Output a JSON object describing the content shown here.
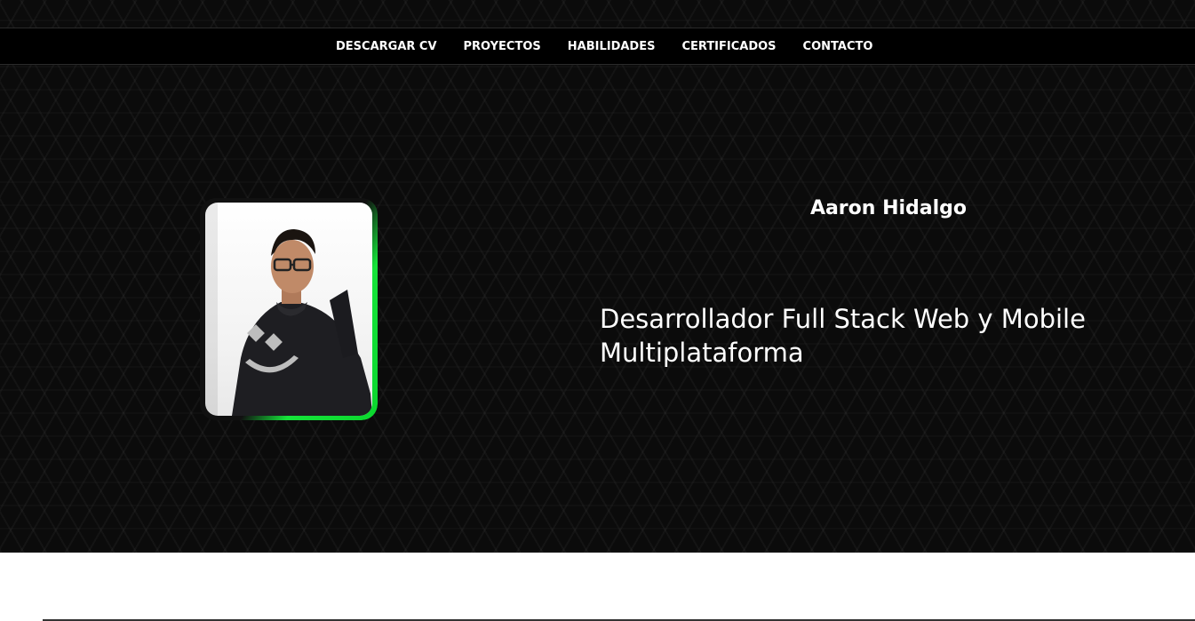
{
  "nav": {
    "items": [
      {
        "label": "DESCARGAR CV"
      },
      {
        "label": "PROYECTOS"
      },
      {
        "label": "HABILIDADES"
      },
      {
        "label": "CERTIFICADOS"
      },
      {
        "label": "CONTACTO"
      }
    ]
  },
  "hero": {
    "name": "Aaron Hidalgo",
    "headline_line1": "Desarrollador Full Stack Web y Mobile",
    "headline_line2": "Multiplataforma"
  },
  "colors": {
    "background": "#0b0b0b",
    "accent": "#16e43a",
    "text": "#ffffff"
  }
}
